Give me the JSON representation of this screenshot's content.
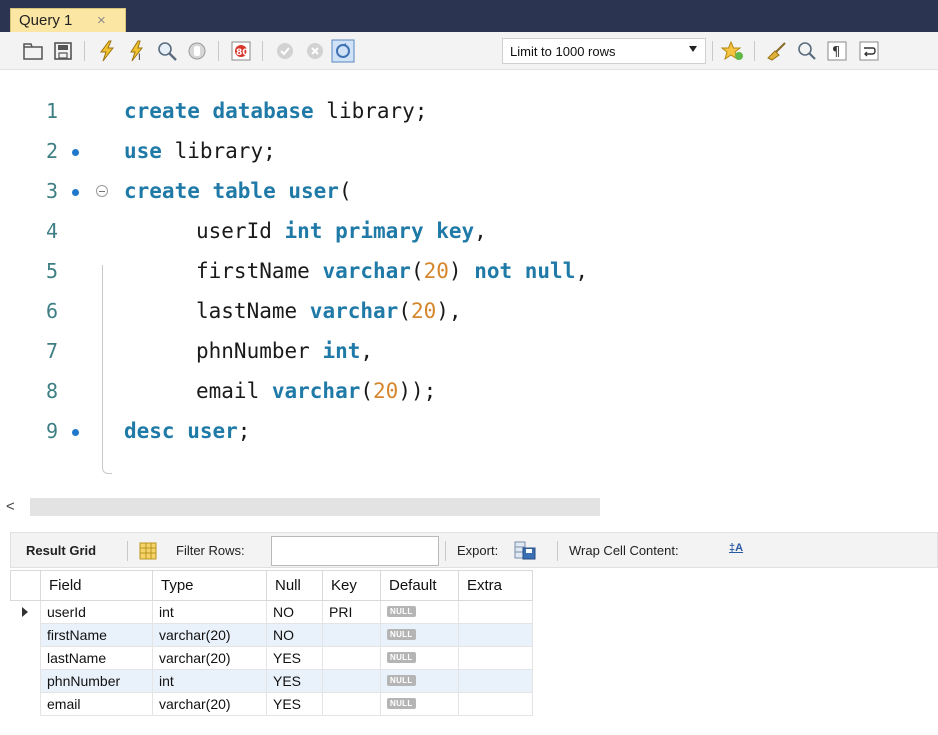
{
  "tab": {
    "label": "Query 1",
    "close": "×"
  },
  "toolbar": {
    "limit_label": "Limit to 1000 rows",
    "icons": [
      "open-file-icon",
      "save-icon",
      "execute-icon",
      "execute-current-icon",
      "explain-icon",
      "stop-icon",
      "toggle-error-icon",
      "commit-icon",
      "rollback-icon",
      "autocommit-icon",
      "bookmark-icon",
      "beautify-icon",
      "find-icon",
      "invisible-chars-icon",
      "wrap-icon"
    ]
  },
  "editor": {
    "lines": [
      {
        "num": "1",
        "dot": false,
        "tokens": [
          {
            "t": "create database",
            "c": "kw"
          },
          {
            "t": " library;",
            "c": ""
          }
        ],
        "indent": 0
      },
      {
        "num": "2",
        "dot": true,
        "tokens": [
          {
            "t": "use",
            "c": "kw"
          },
          {
            "t": " library;",
            "c": ""
          }
        ],
        "indent": 0
      },
      {
        "num": "3",
        "dot": true,
        "fold": true,
        "tokens": [
          {
            "t": "create table user",
            "c": "kw"
          },
          {
            "t": "(",
            "c": ""
          }
        ],
        "indent": 0
      },
      {
        "num": "4",
        "dot": false,
        "tokens": [
          {
            "t": "userId ",
            "c": ""
          },
          {
            "t": "int primary key",
            "c": "kw"
          },
          {
            "t": ",",
            "c": ""
          }
        ],
        "indent": 1
      },
      {
        "num": "5",
        "dot": false,
        "tokens": [
          {
            "t": "firstName ",
            "c": ""
          },
          {
            "t": "varchar",
            "c": "kw"
          },
          {
            "t": "(",
            "c": ""
          },
          {
            "t": "20",
            "c": "num"
          },
          {
            "t": ") ",
            "c": ""
          },
          {
            "t": "not null",
            "c": "kw"
          },
          {
            "t": ",",
            "c": ""
          }
        ],
        "indent": 1
      },
      {
        "num": "6",
        "dot": false,
        "tokens": [
          {
            "t": "lastName ",
            "c": ""
          },
          {
            "t": "varchar",
            "c": "kw"
          },
          {
            "t": "(",
            "c": ""
          },
          {
            "t": "20",
            "c": "num"
          },
          {
            "t": "),",
            "c": ""
          }
        ],
        "indent": 1
      },
      {
        "num": "7",
        "dot": false,
        "tokens": [
          {
            "t": "phnNumber ",
            "c": ""
          },
          {
            "t": "int",
            "c": "kw"
          },
          {
            "t": ",",
            "c": ""
          }
        ],
        "indent": 1
      },
      {
        "num": "8",
        "dot": false,
        "tokens": [
          {
            "t": "email ",
            "c": ""
          },
          {
            "t": "varchar",
            "c": "kw"
          },
          {
            "t": "(",
            "c": ""
          },
          {
            "t": "20",
            "c": "num"
          },
          {
            "t": "));",
            "c": ""
          }
        ],
        "indent": 1
      },
      {
        "num": "9",
        "dot": true,
        "tokens": [
          {
            "t": "desc user",
            "c": "kw"
          },
          {
            "t": ";",
            "c": ""
          }
        ],
        "indent": 0
      }
    ]
  },
  "scrollbar": {
    "left_arrow": "<"
  },
  "result_toolbar": {
    "result_grid_label": "Result Grid",
    "filter_label": "Filter Rows:",
    "filter_value": "",
    "export_label": "Export:",
    "wrap_label": "Wrap Cell Content:",
    "wrap_icon": "‡A"
  },
  "result_grid": {
    "columns": [
      "Field",
      "Type",
      "Null",
      "Key",
      "Default",
      "Extra"
    ],
    "null_text": "NULL",
    "rows": [
      {
        "Field": "userId",
        "Type": "int",
        "Null": "NO",
        "Key": "PRI",
        "Default": "NULL",
        "Extra": ""
      },
      {
        "Field": "firstName",
        "Type": "varchar(20)",
        "Null": "NO",
        "Key": "",
        "Default": "NULL",
        "Extra": ""
      },
      {
        "Field": "lastName",
        "Type": "varchar(20)",
        "Null": "YES",
        "Key": "",
        "Default": "NULL",
        "Extra": ""
      },
      {
        "Field": "phnNumber",
        "Type": "int",
        "Null": "YES",
        "Key": "",
        "Default": "NULL",
        "Extra": ""
      },
      {
        "Field": "email",
        "Type": "varchar(20)",
        "Null": "YES",
        "Key": "",
        "Default": "NULL",
        "Extra": ""
      }
    ]
  },
  "colors": {
    "tabbar": "#2b3552",
    "tab": "#fbe6a3",
    "keyword": "#1f7aa8",
    "number": "#d6862c",
    "line_number": "#3d7f84",
    "row_alt": "#e9f2fb"
  }
}
